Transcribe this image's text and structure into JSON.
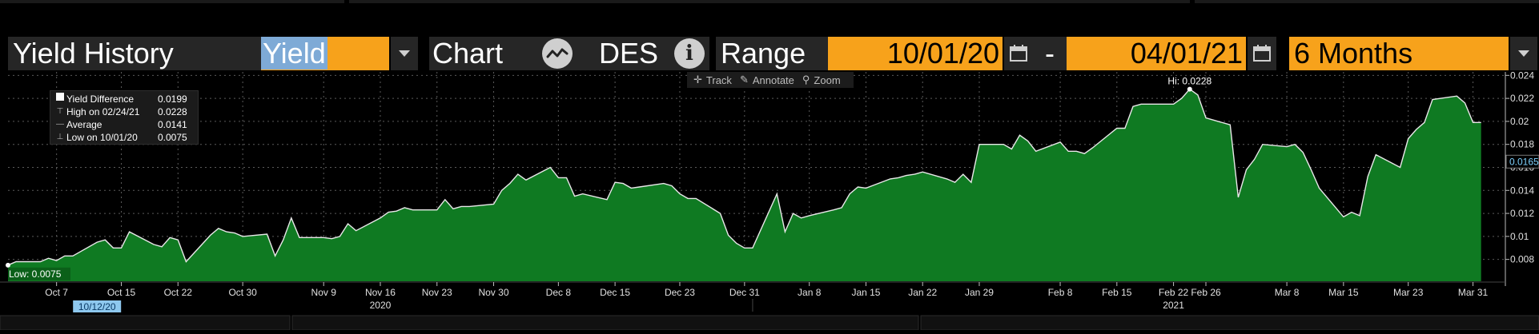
{
  "toolbar": {
    "title": "Yield History",
    "field_value": "Yield",
    "chart_label": "Chart",
    "des_label": "DES",
    "info_icon_glyph": "i",
    "range_label": "Range",
    "start_date": "10/01/20",
    "date_separator": "-",
    "end_date": "04/01/21",
    "period": "6 Months"
  },
  "chart_toolbar": {
    "track": "Track",
    "annotate": "Annotate",
    "zoom": "Zoom"
  },
  "legend": {
    "rows": [
      {
        "label": "Yield Difference",
        "value": "0.0199"
      },
      {
        "label": "High on 02/24/21",
        "value": "0.0228"
      },
      {
        "label": "Average",
        "value": "0.0141"
      },
      {
        "label": "Low on 10/01/20",
        "value": "0.0075"
      }
    ]
  },
  "chart_data": {
    "type": "area",
    "series": [
      {
        "name": "Yield Difference",
        "color": "#0f7a22",
        "x": [
          "2020-10-01",
          "2020-10-02",
          "2020-10-05",
          "2020-10-06",
          "2020-10-07",
          "2020-10-08",
          "2020-10-09",
          "2020-10-12",
          "2020-10-13",
          "2020-10-14",
          "2020-10-15",
          "2020-10-16",
          "2020-10-19",
          "2020-10-20",
          "2020-10-21",
          "2020-10-22",
          "2020-10-23",
          "2020-10-26",
          "2020-10-27",
          "2020-10-28",
          "2020-10-29",
          "2020-10-30",
          "2020-11-02",
          "2020-11-03",
          "2020-11-04",
          "2020-11-05",
          "2020-11-06",
          "2020-11-09",
          "2020-11-10",
          "2020-11-11",
          "2020-11-12",
          "2020-11-13",
          "2020-11-16",
          "2020-11-17",
          "2020-11-18",
          "2020-11-19",
          "2020-11-20",
          "2020-11-23",
          "2020-11-24",
          "2020-11-25",
          "2020-11-26",
          "2020-11-27",
          "2020-11-30",
          "2020-12-01",
          "2020-12-02",
          "2020-12-03",
          "2020-12-04",
          "2020-12-07",
          "2020-12-08",
          "2020-12-09",
          "2020-12-10",
          "2020-12-11",
          "2020-12-14",
          "2020-12-15",
          "2020-12-16",
          "2020-12-17",
          "2020-12-18",
          "2020-12-21",
          "2020-12-22",
          "2020-12-23",
          "2020-12-24",
          "2020-12-25",
          "2020-12-28",
          "2020-12-29",
          "2020-12-30",
          "2020-12-31",
          "2021-01-01",
          "2021-01-04",
          "2021-01-05",
          "2021-01-06",
          "2021-01-07",
          "2021-01-08",
          "2021-01-11",
          "2021-01-12",
          "2021-01-13",
          "2021-01-14",
          "2021-01-15",
          "2021-01-18",
          "2021-01-19",
          "2021-01-20",
          "2021-01-21",
          "2021-01-22",
          "2021-01-25",
          "2021-01-26",
          "2021-01-27",
          "2021-01-28",
          "2021-01-29",
          "2021-02-01",
          "2021-02-02",
          "2021-02-03",
          "2021-02-04",
          "2021-02-05",
          "2021-02-08",
          "2021-02-09",
          "2021-02-10",
          "2021-02-11",
          "2021-02-12",
          "2021-02-15",
          "2021-02-16",
          "2021-02-17",
          "2021-02-18",
          "2021-02-19",
          "2021-02-22",
          "2021-02-23",
          "2021-02-24",
          "2021-02-25",
          "2021-02-26",
          "2021-03-01",
          "2021-03-02",
          "2021-03-03",
          "2021-03-04",
          "2021-03-05",
          "2021-03-08",
          "2021-03-09",
          "2021-03-10",
          "2021-03-11",
          "2021-03-12",
          "2021-03-15",
          "2021-03-16",
          "2021-03-17",
          "2021-03-18",
          "2021-03-19",
          "2021-03-22",
          "2021-03-23",
          "2021-03-24",
          "2021-03-25",
          "2021-03-26",
          "2021-03-29",
          "2021-03-30",
          "2021-03-31",
          "2021-04-01"
        ],
        "values": [
          0.0075,
          0.0078,
          0.0078,
          0.0081,
          0.0079,
          0.0083,
          0.0083,
          0.0095,
          0.0097,
          0.009,
          0.009,
          0.0104,
          0.0093,
          0.0091,
          0.0099,
          0.0097,
          0.0078,
          0.0101,
          0.0107,
          0.0104,
          0.0103,
          0.01,
          0.0102,
          0.0083,
          0.0097,
          0.0116,
          0.0099,
          0.0099,
          0.0098,
          0.01,
          0.0111,
          0.0105,
          0.0116,
          0.0121,
          0.0122,
          0.0125,
          0.0123,
          0.0123,
          0.0132,
          0.0124,
          0.0126,
          0.0126,
          0.0128,
          0.014,
          0.0146,
          0.0154,
          0.0149,
          0.016,
          0.0151,
          0.0151,
          0.0135,
          0.0137,
          0.0132,
          0.0147,
          0.0146,
          0.0142,
          0.0143,
          0.0146,
          0.0144,
          0.0137,
          0.0133,
          0.0133,
          0.012,
          0.0101,
          0.0094,
          0.009,
          0.009,
          0.0137,
          0.0104,
          0.012,
          0.0116,
          0.0118,
          0.0123,
          0.0125,
          0.0137,
          0.0143,
          0.0142,
          0.015,
          0.0151,
          0.0153,
          0.0154,
          0.0156,
          0.015,
          0.0147,
          0.0154,
          0.0147,
          0.018,
          0.018,
          0.0176,
          0.0188,
          0.0183,
          0.0174,
          0.0182,
          0.0174,
          0.0174,
          0.0172,
          0.0177,
          0.0194,
          0.0194,
          0.0213,
          0.0215,
          0.0215,
          0.0215,
          0.022,
          0.0228,
          0.0223,
          0.0203,
          0.0197,
          0.0134,
          0.0158,
          0.0167,
          0.018,
          0.0178,
          0.018,
          0.0173,
          0.0158,
          0.0142,
          0.0117,
          0.0121,
          0.0118,
          0.0152,
          0.0171,
          0.016,
          0.0185,
          0.0193,
          0.0199,
          0.0219,
          0.0222,
          0.0216,
          0.0199,
          0.0199
        ]
      }
    ],
    "x_tick_labels": [
      "Oct 7",
      "Oct 15",
      "Oct 22",
      "Oct 30",
      "Nov 9",
      "Nov 16",
      "Nov 23",
      "Nov 30",
      "Dec 8",
      "Dec 15",
      "Dec 23",
      "Dec 31",
      "Jan 8",
      "Jan 15",
      "Jan 22",
      "Jan 29",
      "Feb 8",
      "Feb 15",
      "Feb 22",
      "Feb 26",
      "Mar 8",
      "Mar 15",
      "Mar 23",
      "Mar 31"
    ],
    "x_tick_dates": [
      "2020-10-07",
      "2020-10-15",
      "2020-10-22",
      "2020-10-30",
      "2020-11-09",
      "2020-11-16",
      "2020-11-23",
      "2020-11-30",
      "2020-12-08",
      "2020-12-15",
      "2020-12-23",
      "2020-12-31",
      "2021-01-08",
      "2021-01-15",
      "2021-01-22",
      "2021-01-29",
      "2021-02-08",
      "2021-02-15",
      "2021-02-22",
      "2021-02-26",
      "2021-03-08",
      "2021-03-15",
      "2021-03-23",
      "2021-03-31"
    ],
    "year_labels": [
      {
        "label": "2020",
        "date": "2020-11-16"
      },
      {
        "label": "2021",
        "date": "2021-02-22"
      }
    ],
    "cursor_date_label": "10/12/20",
    "cursor_date": "2020-10-12",
    "y_ticks": [
      0.008,
      0.01,
      0.012,
      0.014,
      0.016,
      0.018,
      0.02,
      0.022,
      0.024
    ],
    "y_tick_labels": [
      "0.008",
      "0.01",
      "0.012",
      "0.014",
      "0.016",
      "0.018",
      "0.02",
      "0.022",
      "0.024"
    ],
    "ylim": [
      0.0061,
      0.0243
    ],
    "xlim": [
      "2020-10-01",
      "2021-04-04"
    ],
    "current_value_label": "0.0165",
    "current_value": 0.0165,
    "high_annotation": {
      "label": "Hi: 0.0228",
      "date": "2021-02-24",
      "value": 0.0228
    },
    "low_annotation": {
      "label": "Low: 0.0075",
      "date": "2020-10-01",
      "value": 0.0075
    },
    "grid": true,
    "legend_position": "top-left"
  }
}
